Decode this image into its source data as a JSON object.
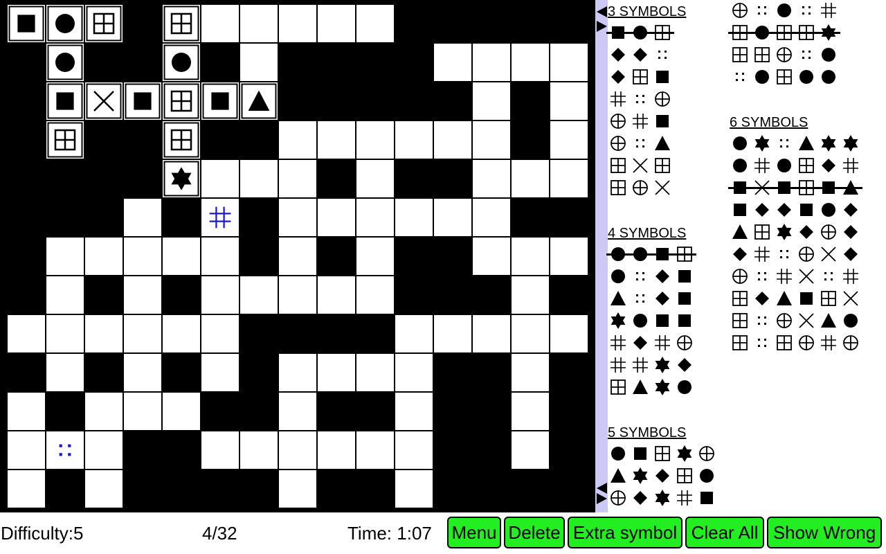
{
  "grid": {
    "rows": [
      "WWWBWWWWWWBBBBB",
      "BWBBWBWBBBBWWWW",
      "BWWWWWWBBBBBWBW",
      "BWBBWBBWWWWWWBW",
      "BBBBWWWWBWBBWWW",
      "BBBWBWBWWWWWWBB",
      "BWWWWWBWBWBBWWW",
      "BWBWBWWWWWBBBWB",
      "WWWWWWBBBBWWWWW",
      "BWBWBWBWWWWBBWB",
      "WBWWWBBWBBWBBWB",
      "WWWBBWWWWWWBBWB",
      "WBWBBBBWBBWBBBB"
    ],
    "symbols": [
      {
        "r": 0,
        "c": 0,
        "s": "square"
      },
      {
        "r": 0,
        "c": 1,
        "s": "circle"
      },
      {
        "r": 0,
        "c": 2,
        "s": "window"
      },
      {
        "r": 0,
        "c": 4,
        "s": "window"
      },
      {
        "r": 1,
        "c": 1,
        "s": "circle"
      },
      {
        "r": 1,
        "c": 4,
        "s": "circle"
      },
      {
        "r": 2,
        "c": 1,
        "s": "square"
      },
      {
        "r": 2,
        "c": 2,
        "s": "cross"
      },
      {
        "r": 2,
        "c": 3,
        "s": "square"
      },
      {
        "r": 2,
        "c": 4,
        "s": "window"
      },
      {
        "r": 2,
        "c": 5,
        "s": "square"
      },
      {
        "r": 2,
        "c": 6,
        "s": "triangle"
      },
      {
        "r": 3,
        "c": 1,
        "s": "window"
      },
      {
        "r": 3,
        "c": 4,
        "s": "window"
      },
      {
        "r": 4,
        "c": 4,
        "s": "star"
      },
      {
        "r": 5,
        "c": 5,
        "s": "hash",
        "color": "#1a1acc"
      },
      {
        "r": 11,
        "c": 1,
        "s": "dots",
        "color": "#1a1acc"
      }
    ]
  },
  "sections": [
    {
      "title": "3 SYMBOLS",
      "words": [
        {
          "s": [
            "square",
            "circle",
            "window"
          ],
          "done": true
        },
        {
          "s": [
            "diamond",
            "diamond",
            "dots"
          ]
        },
        {
          "s": [
            "diamond",
            "window",
            "square"
          ]
        },
        {
          "s": [
            "hash",
            "dots",
            "ocross"
          ]
        },
        {
          "s": [
            "ocross",
            "hash",
            "square"
          ]
        },
        {
          "s": [
            "ocross",
            "dots",
            "triangle"
          ]
        },
        {
          "s": [
            "window",
            "cross",
            "window"
          ]
        },
        {
          "s": [
            "window",
            "ocross",
            "cross"
          ]
        }
      ]
    },
    {
      "title": "4 SYMBOLS",
      "words": [
        {
          "s": [
            "circle",
            "circle",
            "square",
            "window"
          ],
          "done": true
        },
        {
          "s": [
            "circle",
            "dots",
            "diamond",
            "square"
          ]
        },
        {
          "s": [
            "triangle",
            "dots",
            "diamond",
            "square"
          ]
        },
        {
          "s": [
            "star",
            "circle",
            "square",
            "square"
          ]
        },
        {
          "s": [
            "hash",
            "diamond",
            "hash",
            "ocross"
          ]
        },
        {
          "s": [
            "hash",
            "hash",
            "star",
            "diamond"
          ]
        },
        {
          "s": [
            "window",
            "triangle",
            "star",
            "circle"
          ]
        }
      ]
    },
    {
      "title": "5 SYMBOLS",
      "words": [
        {
          "s": [
            "circle",
            "square",
            "window",
            "star",
            "ocross"
          ]
        },
        {
          "s": [
            "triangle",
            "star",
            "diamond",
            "window",
            "circle"
          ]
        },
        {
          "s": [
            "ocross",
            "diamond",
            "star",
            "hash",
            "square"
          ]
        },
        {
          "s": [
            "ocross",
            "dots",
            "circle",
            "dots",
            "hash"
          ]
        },
        {
          "s": [
            "window",
            "circle",
            "window",
            "window",
            "star"
          ],
          "done": true
        },
        {
          "s": [
            "window",
            "window",
            "ocross",
            "dots",
            "circle"
          ]
        },
        {
          "s": [
            "dots",
            "circle",
            "window",
            "circle",
            "circle"
          ]
        }
      ]
    },
    {
      "title": "6 SYMBOLS",
      "words": [
        {
          "s": [
            "circle",
            "star",
            "dots",
            "triangle",
            "star",
            "star"
          ]
        },
        {
          "s": [
            "circle",
            "hash",
            "circle",
            "window",
            "diamond",
            "hash"
          ]
        },
        {
          "s": [
            "square",
            "cross",
            "square",
            "window",
            "square",
            "triangle"
          ],
          "done": true
        },
        {
          "s": [
            "square",
            "diamond",
            "diamond",
            "square",
            "circle",
            "diamond"
          ]
        },
        {
          "s": [
            "triangle",
            "window",
            "star",
            "diamond",
            "ocross",
            "diamond"
          ]
        },
        {
          "s": [
            "diamond",
            "hash",
            "dots",
            "ocross",
            "cross",
            "diamond"
          ]
        },
        {
          "s": [
            "ocross",
            "dots",
            "hash",
            "cross",
            "dots",
            "hash"
          ]
        },
        {
          "s": [
            "window",
            "diamond",
            "triangle",
            "square",
            "window",
            "cross"
          ]
        },
        {
          "s": [
            "window",
            "dots",
            "ocross",
            "cross",
            "triangle",
            "circle"
          ]
        },
        {
          "s": [
            "window",
            "dots",
            "window",
            "ocross",
            "hash",
            "ocross"
          ]
        }
      ]
    }
  ],
  "status": {
    "difficulty": "Difficulty:5",
    "progress": "4/32",
    "time": "Time: 1:07"
  },
  "buttons": {
    "menu": "Menu",
    "delete": "Delete",
    "extra": "Extra symbol",
    "clear": "Clear All",
    "wrong": "Show Wrong"
  },
  "colors": {
    "wall": "#000000",
    "cell": "#ffffff",
    "selected_symbol": "#1a1acc",
    "divider": "#cccaf5",
    "button": "#22ee22"
  }
}
